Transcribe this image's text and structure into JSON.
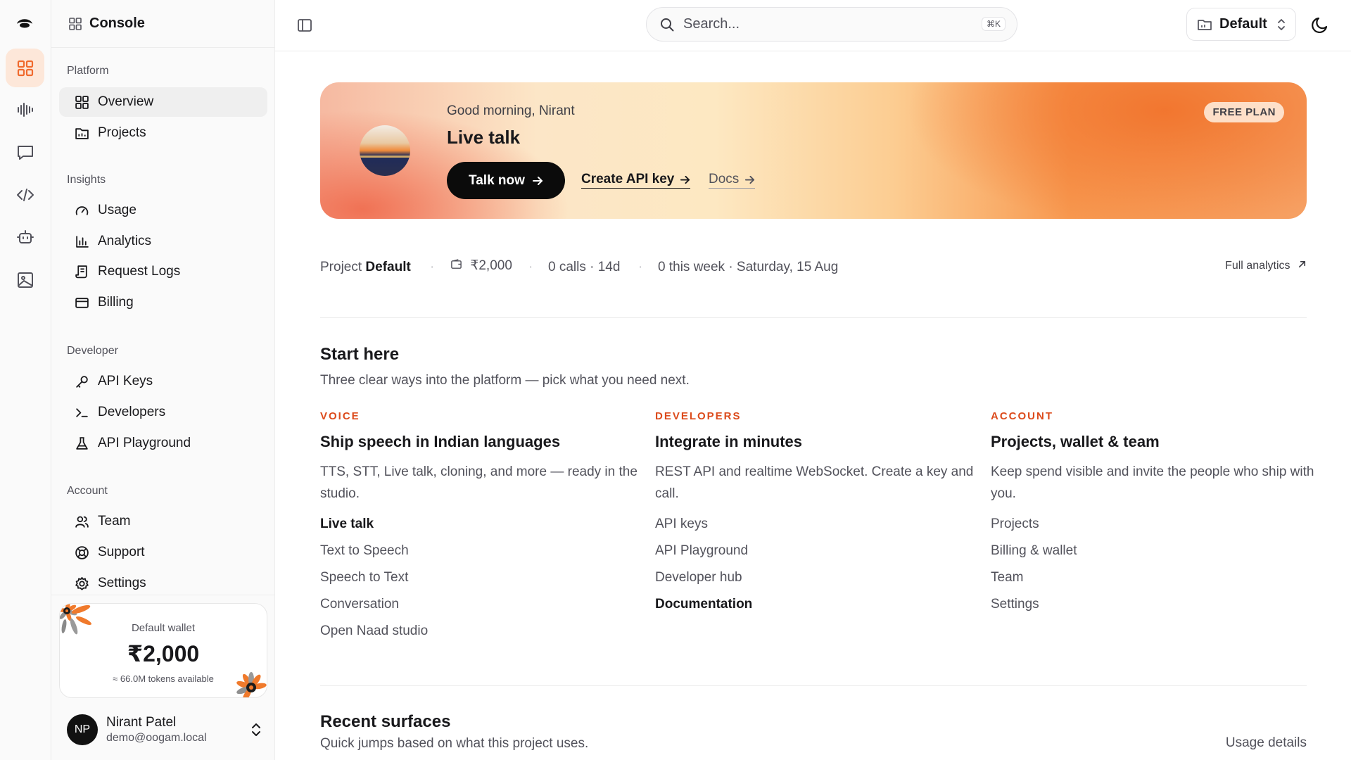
{
  "sidebar": {
    "title": "Console",
    "sections": {
      "platform": "Platform",
      "insights": "Insights",
      "developer": "Developer",
      "account": "Account"
    },
    "items": {
      "overview": "Overview",
      "projects": "Projects",
      "usage": "Usage",
      "analytics": "Analytics",
      "request_logs": "Request Logs",
      "billing": "Billing",
      "api_keys": "API Keys",
      "developers": "Developers",
      "api_playground": "API Playground",
      "team": "Team",
      "support": "Support",
      "settings": "Settings"
    },
    "wallet": {
      "label": "Default wallet",
      "amount": "₹2,000",
      "tokens": "≈ 66.0M tokens available"
    },
    "user": {
      "initials": "NP",
      "name": "Nirant Patel",
      "email": "demo@oogam.local"
    }
  },
  "topbar": {
    "search_placeholder": "Search...",
    "shortcut": "⌘K",
    "project": "Default"
  },
  "hero": {
    "greeting": "Good morning, Nirant",
    "title": "Live talk",
    "talk_button": "Talk now",
    "api_link": "Create API key",
    "docs_link": "Docs",
    "plan_badge": "FREE PLAN"
  },
  "stats": {
    "project_label": "Project",
    "project_value": "Default",
    "balance": "₹2,000",
    "calls": "0 calls · 14d",
    "week": "0 this week · Saturday, 15 Aug",
    "full_analytics": "Full analytics"
  },
  "start_here": {
    "title": "Start here",
    "subtitle": "Three clear ways into the platform — pick what you need next.",
    "columns": [
      {
        "kicker": "VOICE",
        "title": "Ship speech in Indian languages",
        "desc": "TTS, STT, Live talk, cloning, and more — ready in the studio.",
        "links": [
          "Live talk",
          "Text to Speech",
          "Speech to Text",
          "Conversation",
          "Open Naad studio"
        ]
      },
      {
        "kicker": "DEVELOPERS",
        "title": "Integrate in minutes",
        "desc": "REST API and realtime WebSocket. Create a key and call.",
        "links": [
          "API keys",
          "API Playground",
          "Developer hub",
          "Documentation"
        ]
      },
      {
        "kicker": "ACCOUNT",
        "title": "Projects, wallet & team",
        "desc": "Keep spend visible and invite the people who ship with you.",
        "links": [
          "Projects",
          "Billing & wallet",
          "Team",
          "Settings"
        ]
      }
    ]
  },
  "recent": {
    "title": "Recent surfaces",
    "subtitle": "Quick jumps based on what this project uses.",
    "usage_details": "Usage details"
  },
  "colors": {
    "accent": "#dc4b1c",
    "accent_soft": "#fde7d9",
    "text": "#18181b",
    "muted": "#52525b"
  }
}
